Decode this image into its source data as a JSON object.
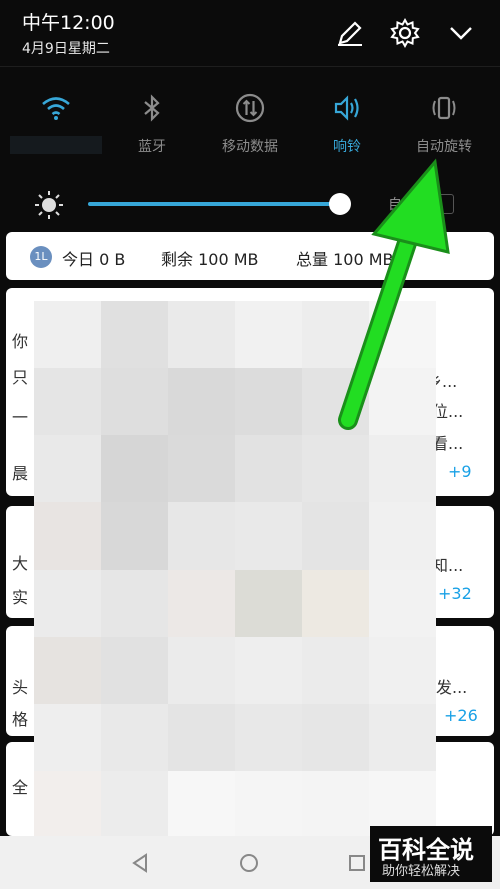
{
  "status_bar": {
    "time": "中午12:00",
    "date": "4月9日星期二"
  },
  "header_icons": [
    "edit-icon",
    "settings-icon",
    "chevron-down-icon"
  ],
  "quick_toggles": [
    {
      "label": "",
      "icon": "wifi-icon",
      "active": true
    },
    {
      "label": "蓝牙",
      "icon": "bluetooth-icon",
      "active": false
    },
    {
      "label": "移动数据",
      "icon": "mobile-data-icon",
      "active": false
    },
    {
      "label": "响铃",
      "icon": "ring-icon",
      "active": true
    },
    {
      "label": "自动旋转",
      "icon": "auto-rotate-icon",
      "active": false
    }
  ],
  "brightness": {
    "level": 0.96,
    "auto_label": "自"
  },
  "data_usage": {
    "badge": "1L",
    "today": "今日 0 B",
    "remaining": "剩余 100 MB",
    "total": "总量 100 MB"
  },
  "notifications": [
    {
      "fragments_left": [
        "你",
        "只",
        "一",
        "晨"
      ],
      "fragments_right": [
        "乡...",
        "位...",
        "看..."
      ],
      "more_count": "+9"
    },
    {
      "fragments_left": [
        "大",
        "实"
      ],
      "fragments_right": [
        "知..."
      ],
      "more_count": "+32"
    },
    {
      "fragments_left": [
        "头",
        "格"
      ],
      "fragments_right": [
        "发..."
      ],
      "more_count": "+26"
    },
    {
      "fragments_left": [
        "全"
      ],
      "fragments_right": [],
      "more_count": ""
    }
  ],
  "watermark": {
    "title": "百科全说",
    "subtitle": "助你轻松解决"
  },
  "colors": {
    "accent": "#37a7d8",
    "arrow": "#22dd22",
    "count": "#1aa1e6"
  }
}
